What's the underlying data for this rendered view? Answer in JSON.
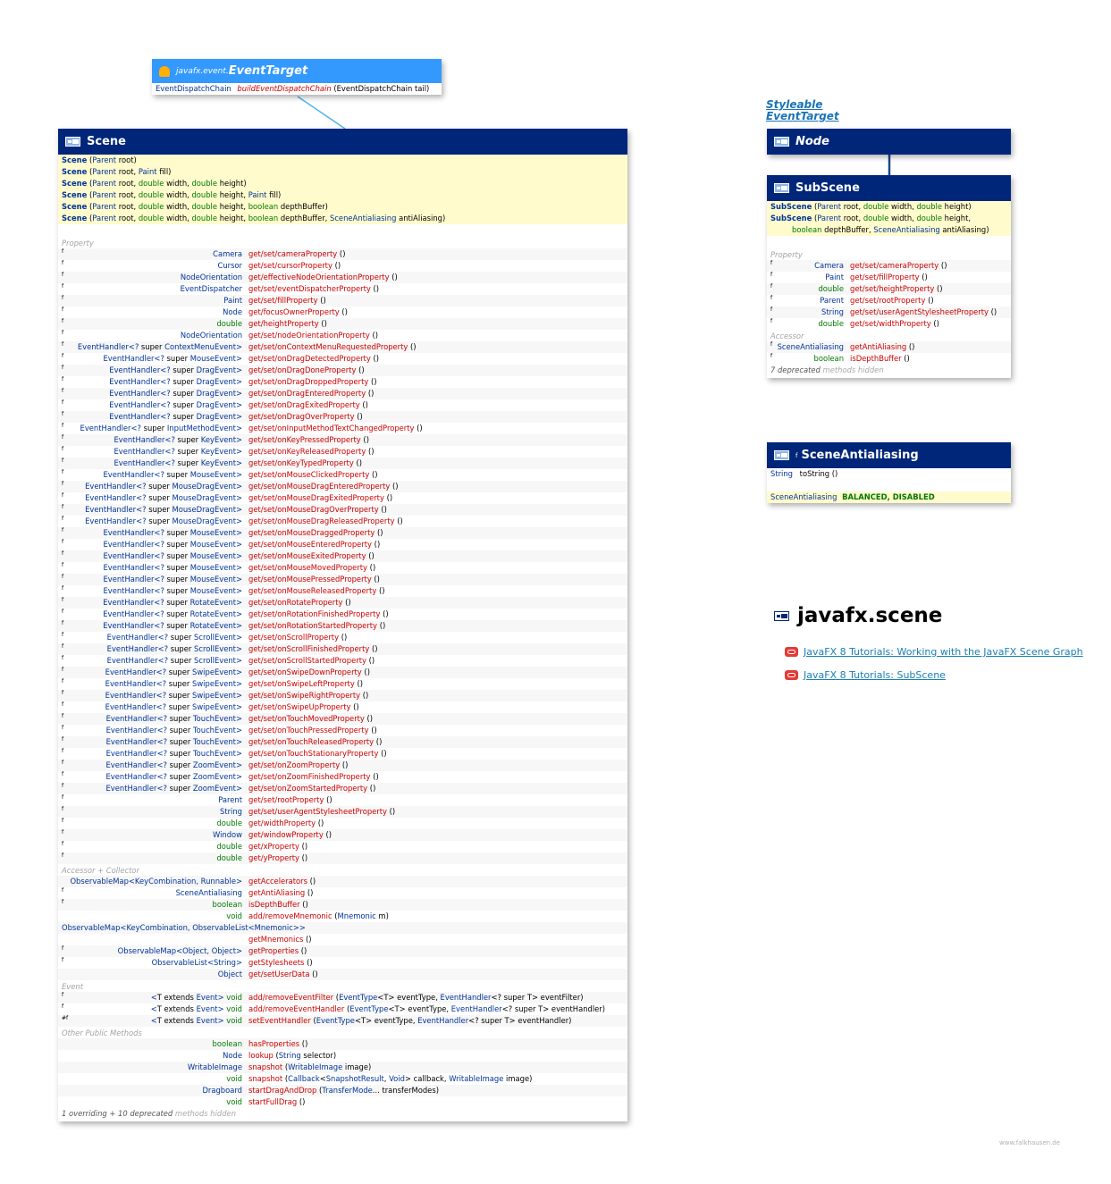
{
  "event_target": {
    "package": "javafx.event.",
    "name": "EventTarget",
    "method": {
      "type": "EventDispatchChain",
      "name": "buildEventDispatchChain",
      "params": "(EventDispatchChain tail)"
    }
  },
  "node_links": [
    "Styleable",
    "EventTarget"
  ],
  "node": {
    "name": "Node"
  },
  "scene": {
    "name": "Scene",
    "ctor_name": "Scene",
    "constructors": [
      " (Parent root)",
      " (Parent root, Paint fill)",
      " (Parent root, double width, double height)",
      " (Parent root, double width, double height, Paint fill)",
      " (Parent root, double width, double height, boolean depthBuffer)",
      " (Parent root, double width, double height, boolean depthBuffer, SceneAntialiasing antiAliasing)"
    ],
    "sections": [
      {
        "title": "Property",
        "rows": [
          {
            "m": "f",
            "t": "Camera",
            "n": "get/set/cameraProperty",
            "a": " ()"
          },
          {
            "m": "f",
            "t": "Cursor",
            "n": "get/set/cursorProperty",
            "a": " ()"
          },
          {
            "m": "f",
            "t": "NodeOrientation",
            "n": "get/effectiveNodeOrientationProperty",
            "a": " ()"
          },
          {
            "m": "f",
            "t": "EventDispatcher",
            "n": "get/set/eventDispatcherProperty",
            "a": " ()"
          },
          {
            "m": "f",
            "t": "Paint",
            "n": "get/set/fillProperty",
            "a": " ()"
          },
          {
            "m": "f",
            "t": "Node",
            "n": "get/focusOwnerProperty",
            "a": " ()"
          },
          {
            "m": "f",
            "t": "double",
            "n": "get/heightProperty",
            "a": " ()"
          },
          {
            "m": "f",
            "t": "NodeOrientation",
            "n": "get/set/nodeOrientationProperty",
            "a": " ()"
          },
          {
            "m": "f",
            "t": "EventHandler<? super ContextMenuEvent>",
            "n": "get/set/onContextMenuRequestedProperty",
            "a": " ()"
          },
          {
            "m": "f",
            "t": "EventHandler<? super MouseEvent>",
            "n": "get/set/onDragDetectedProperty",
            "a": " ()"
          },
          {
            "m": "f",
            "t": "EventHandler<? super DragEvent>",
            "n": "get/set/onDragDoneProperty",
            "a": " ()"
          },
          {
            "m": "f",
            "t": "EventHandler<? super DragEvent>",
            "n": "get/set/onDragDroppedProperty",
            "a": " ()"
          },
          {
            "m": "f",
            "t": "EventHandler<? super DragEvent>",
            "n": "get/set/onDragEnteredProperty",
            "a": " ()"
          },
          {
            "m": "f",
            "t": "EventHandler<? super DragEvent>",
            "n": "get/set/onDragExitedProperty",
            "a": " ()"
          },
          {
            "m": "f",
            "t": "EventHandler<? super DragEvent>",
            "n": "get/set/onDragOverProperty",
            "a": " ()"
          },
          {
            "m": "f",
            "t": "EventHandler<? super InputMethodEvent>",
            "n": "get/set/onInputMethodTextChangedProperty",
            "a": " ()"
          },
          {
            "m": "f",
            "t": "EventHandler<? super KeyEvent>",
            "n": "get/set/onKeyPressedProperty",
            "a": " ()"
          },
          {
            "m": "f",
            "t": "EventHandler<? super KeyEvent>",
            "n": "get/set/onKeyReleasedProperty",
            "a": " ()"
          },
          {
            "m": "f",
            "t": "EventHandler<? super KeyEvent>",
            "n": "get/set/onKeyTypedProperty",
            "a": " ()"
          },
          {
            "m": "f",
            "t": "EventHandler<? super MouseEvent>",
            "n": "get/set/onMouseClickedProperty",
            "a": " ()"
          },
          {
            "m": "f",
            "t": "EventHandler<? super MouseDragEvent>",
            "n": "get/set/onMouseDragEnteredProperty",
            "a": " ()"
          },
          {
            "m": "f",
            "t": "EventHandler<? super MouseDragEvent>",
            "n": "get/set/onMouseDragExitedProperty",
            "a": " ()"
          },
          {
            "m": "f",
            "t": "EventHandler<? super MouseDragEvent>",
            "n": "get/set/onMouseDragOverProperty",
            "a": " ()"
          },
          {
            "m": "f",
            "t": "EventHandler<? super MouseDragEvent>",
            "n": "get/set/onMouseDragReleasedProperty",
            "a": " ()"
          },
          {
            "m": "f",
            "t": "EventHandler<? super MouseEvent>",
            "n": "get/set/onMouseDraggedProperty",
            "a": " ()"
          },
          {
            "m": "f",
            "t": "EventHandler<? super MouseEvent>",
            "n": "get/set/onMouseEnteredProperty",
            "a": " ()"
          },
          {
            "m": "f",
            "t": "EventHandler<? super MouseEvent>",
            "n": "get/set/onMouseExitedProperty",
            "a": " ()"
          },
          {
            "m": "f",
            "t": "EventHandler<? super MouseEvent>",
            "n": "get/set/onMouseMovedProperty",
            "a": " ()"
          },
          {
            "m": "f",
            "t": "EventHandler<? super MouseEvent>",
            "n": "get/set/onMousePressedProperty",
            "a": " ()"
          },
          {
            "m": "f",
            "t": "EventHandler<? super MouseEvent>",
            "n": "get/set/onMouseReleasedProperty",
            "a": " ()"
          },
          {
            "m": "f",
            "t": "EventHandler<? super RotateEvent>",
            "n": "get/set/onRotateProperty",
            "a": " ()"
          },
          {
            "m": "f",
            "t": "EventHandler<? super RotateEvent>",
            "n": "get/set/onRotationFinishedProperty",
            "a": " ()"
          },
          {
            "m": "f",
            "t": "EventHandler<? super RotateEvent>",
            "n": "get/set/onRotationStartedProperty",
            "a": " ()"
          },
          {
            "m": "f",
            "t": "EventHandler<? super ScrollEvent>",
            "n": "get/set/onScrollProperty",
            "a": " ()"
          },
          {
            "m": "f",
            "t": "EventHandler<? super ScrollEvent>",
            "n": "get/set/onScrollFinishedProperty",
            "a": " ()"
          },
          {
            "m": "f",
            "t": "EventHandler<? super ScrollEvent>",
            "n": "get/set/onScrollStartedProperty",
            "a": " ()"
          },
          {
            "m": "f",
            "t": "EventHandler<? super SwipeEvent>",
            "n": "get/set/onSwipeDownProperty",
            "a": " ()"
          },
          {
            "m": "f",
            "t": "EventHandler<? super SwipeEvent>",
            "n": "get/set/onSwipeLeftProperty",
            "a": " ()"
          },
          {
            "m": "f",
            "t": "EventHandler<? super SwipeEvent>",
            "n": "get/set/onSwipeRightProperty",
            "a": " ()"
          },
          {
            "m": "f",
            "t": "EventHandler<? super SwipeEvent>",
            "n": "get/set/onSwipeUpProperty",
            "a": " ()"
          },
          {
            "m": "f",
            "t": "EventHandler<? super TouchEvent>",
            "n": "get/set/onTouchMovedProperty",
            "a": " ()"
          },
          {
            "m": "f",
            "t": "EventHandler<? super TouchEvent>",
            "n": "get/set/onTouchPressedProperty",
            "a": " ()"
          },
          {
            "m": "f",
            "t": "EventHandler<? super TouchEvent>",
            "n": "get/set/onTouchReleasedProperty",
            "a": " ()"
          },
          {
            "m": "f",
            "t": "EventHandler<? super TouchEvent>",
            "n": "get/set/onTouchStationaryProperty",
            "a": " ()"
          },
          {
            "m": "f",
            "t": "EventHandler<? super ZoomEvent>",
            "n": "get/set/onZoomProperty",
            "a": " ()"
          },
          {
            "m": "f",
            "t": "EventHandler<? super ZoomEvent>",
            "n": "get/set/onZoomFinishedProperty",
            "a": " ()"
          },
          {
            "m": "f",
            "t": "EventHandler<? super ZoomEvent>",
            "n": "get/set/onZoomStartedProperty",
            "a": " ()"
          },
          {
            "m": "f",
            "t": "Parent",
            "n": "get/set/rootProperty",
            "a": " ()"
          },
          {
            "m": "f",
            "t": "String",
            "n": "get/set/userAgentStylesheetProperty",
            "a": " ()"
          },
          {
            "m": "f",
            "t": "double",
            "n": "get/widthProperty",
            "a": " ()"
          },
          {
            "m": "f",
            "t": "Window",
            "n": "get/windowProperty",
            "a": " ()"
          },
          {
            "m": "f",
            "t": "double",
            "n": "get/xProperty",
            "a": " ()"
          },
          {
            "m": "f",
            "t": "double",
            "n": "get/yProperty",
            "a": " ()"
          }
        ]
      },
      {
        "title": "Accessor + Collector",
        "rows": [
          {
            "m": "",
            "t": "ObservableMap<KeyCombination, Runnable>",
            "n": "getAccelerators",
            "a": " ()"
          },
          {
            "m": "f",
            "t": "SceneAntialiasing",
            "n": "getAntiAliasing",
            "a": " ()"
          },
          {
            "m": "f",
            "t": "boolean",
            "n": "isDepthBuffer",
            "a": " ()"
          },
          {
            "m": "",
            "t": "void",
            "n": "add/removeMnemonic",
            "a": " (Mnemonic m)"
          },
          {
            "m": "",
            "t": "ObservableMap<KeyCombination, ObservableList<Mnemonic>>",
            "n": "",
            "a": "",
            "wide": true
          },
          {
            "m": "",
            "t": "",
            "n": "getMnemonics",
            "a": " ()"
          },
          {
            "m": "f",
            "t": "ObservableMap<Object, Object>",
            "n": "getProperties",
            "a": " ()"
          },
          {
            "m": "f",
            "t": "ObservableList<String>",
            "n": "getStylesheets",
            "a": " ()"
          },
          {
            "m": "",
            "t": "Object",
            "n": "get/setUserData",
            "a": " ()"
          }
        ]
      },
      {
        "title": "Event",
        "rows": [
          {
            "m": "f",
            "t": "<T extends Event> void",
            "n": "add/removeEventFilter",
            "a": " (EventType<T> eventType, EventHandler<? super T> eventFilter)"
          },
          {
            "m": "f",
            "t": "<T extends Event> void",
            "n": "add/removeEventHandler",
            "a": " (EventType<T> eventType, EventHandler<? super T> eventHandler)"
          },
          {
            "m": "#f",
            "t": "<T extends Event> void",
            "n": "setEventHandler",
            "a": " (EventType<T> eventType, EventHandler<? super T> eventHandler)"
          }
        ]
      },
      {
        "title": "Other Public Methods",
        "rows": [
          {
            "m": "",
            "t": "boolean",
            "n": "hasProperties",
            "a": " ()"
          },
          {
            "m": "",
            "t": "Node",
            "n": "lookup",
            "a": " (String selector)"
          },
          {
            "m": "",
            "t": "WritableImage",
            "n": "snapshot",
            "a": " (WritableImage image)"
          },
          {
            "m": "",
            "t": "void",
            "n": "snapshot",
            "a": " (Callback<SnapshotResult, Void> callback, WritableImage image)"
          },
          {
            "m": "",
            "t": "Dragboard",
            "n": "startDragAndDrop",
            "a": " (TransferMode... transferModes)"
          },
          {
            "m": "",
            "t": "void",
            "n": "startFullDrag",
            "a": " ()"
          }
        ]
      }
    ],
    "footer": "1 overriding + 10 deprecated",
    "footer_hidden": " methods hidden"
  },
  "subscene": {
    "name": "SubScene",
    "ctor_name": "SubScene",
    "constructors": [
      " (Parent root, double width, double height)",
      " (Parent root, double width, double height, boolean depthBuffer, SceneAntialiasing antiAliasing)"
    ],
    "sections": [
      {
        "title": "Property",
        "rows": [
          {
            "m": "f",
            "t": "Camera",
            "n": "get/set/cameraProperty",
            "a": " ()"
          },
          {
            "m": "f",
            "t": "Paint",
            "n": "get/set/fillProperty",
            "a": " ()"
          },
          {
            "m": "f",
            "t": "double",
            "n": "get/set/heightProperty",
            "a": " ()"
          },
          {
            "m": "f",
            "t": "Parent",
            "n": "get/set/rootProperty",
            "a": " ()"
          },
          {
            "m": "f",
            "t": "String",
            "n": "get/set/userAgentStylesheetProperty",
            "a": " ()"
          },
          {
            "m": "f",
            "t": "double",
            "n": "get/set/widthProperty",
            "a": " ()"
          }
        ]
      },
      {
        "title": "Accessor",
        "rows": [
          {
            "m": "f",
            "t": "SceneAntialiasing",
            "n": "getAntiAliasing",
            "a": " ()"
          },
          {
            "m": "f",
            "t": "boolean",
            "n": "isDepthBuffer",
            "a": " ()"
          }
        ]
      }
    ],
    "footer": "7 deprecated",
    "footer_hidden": " methods hidden"
  },
  "antialiasing": {
    "name": "SceneAntialiasing",
    "final_marker": "f",
    "method_type": "String",
    "method_name": "toString",
    "method_args": " ()",
    "enum_type": "SceneAntialiasing",
    "enum_values": "BALANCED, DISABLED"
  },
  "package": {
    "name": "javafx.scene",
    "links": [
      "JavaFX 8 Tutorials: Working with the JavaFX Scene Graph",
      "JavaFX 8 Tutorials: SubScene"
    ]
  },
  "watermark": "www.falkhausen.de",
  "colors": {
    "header": "#00267a",
    "interface_header": "#3399ff",
    "ctor_bg": "#fffbcc",
    "method": "#cc0000",
    "type": "#003399"
  }
}
